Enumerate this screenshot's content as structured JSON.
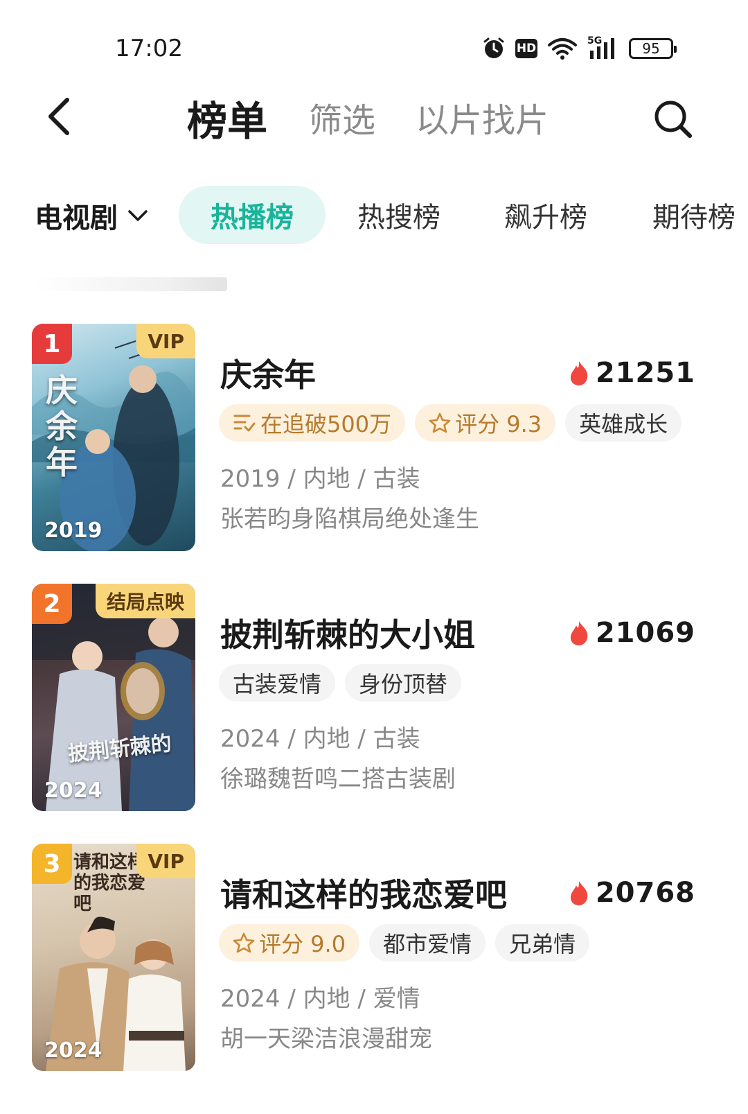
{
  "status_bar": {
    "time": "17:02",
    "hd": "HD",
    "network": "5G",
    "battery": "95"
  },
  "nav": {
    "tabs": [
      "榜单",
      "筛选",
      "以片找片"
    ]
  },
  "filter": {
    "category": "电视剧",
    "tabs": [
      "热播榜",
      "热搜榜",
      "飙升榜",
      "期待榜"
    ],
    "accent_color": "#19b49a"
  },
  "items": [
    {
      "rank": "1",
      "corner_badge": "VIP",
      "poster_year": "2019",
      "poster_art": "庆余年",
      "title": "庆余年",
      "heat": "21251",
      "tags": [
        {
          "text": "在追破500万",
          "style": "warm",
          "icon": "list-check-icon"
        },
        {
          "text": "评分 9.3",
          "style": "warm",
          "icon": "star-icon"
        },
        {
          "text": "英雄成长",
          "style": "plain",
          "icon": ""
        }
      ],
      "meta": "2019 / 内地 / 古装",
      "desc": "张若昀身陷棋局绝处逢生"
    },
    {
      "rank": "2",
      "corner_badge": "结局点映",
      "poster_year": "2024",
      "poster_art": "披荆斩棘的",
      "title": "披荆斩棘的大小姐",
      "heat": "21069",
      "tags": [
        {
          "text": "古装爱情",
          "style": "plain",
          "icon": ""
        },
        {
          "text": "身份顶替",
          "style": "plain",
          "icon": ""
        }
      ],
      "meta": "2024 / 内地 / 古装",
      "desc": "徐璐魏哲鸣二搭古装剧"
    },
    {
      "rank": "3",
      "corner_badge": "VIP",
      "poster_year": "2024",
      "poster_art": "请和这样的我恋爱吧",
      "title": "请和这样的我恋爱吧",
      "heat": "20768",
      "tags": [
        {
          "text": "评分 9.0",
          "style": "warm",
          "icon": "star-icon"
        },
        {
          "text": "都市爱情",
          "style": "plain",
          "icon": ""
        },
        {
          "text": "兄弟情",
          "style": "plain",
          "icon": ""
        }
      ],
      "meta": "2024 / 内地 / 爱情",
      "desc": "胡一天梁洁浪漫甜宠"
    }
  ]
}
